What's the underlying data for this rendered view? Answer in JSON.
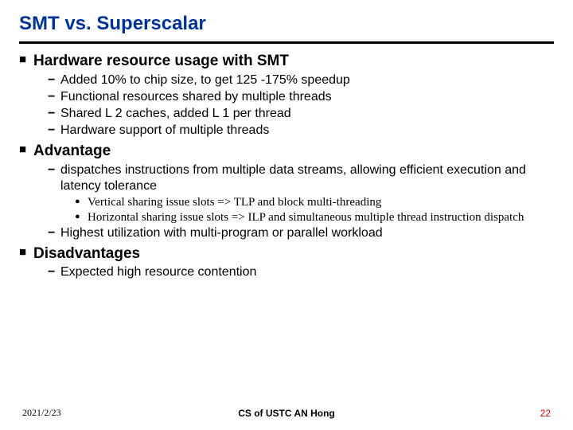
{
  "title": "SMT vs. Superscalar",
  "sections": [
    {
      "heading": "Hardware resource usage with SMT",
      "items": [
        {
          "text": "Added 10% to chip size, to get 125 -175% speedup"
        },
        {
          "text": "Functional resources shared by multiple threads"
        },
        {
          "text": "Shared L 2 caches, added L 1 per thread"
        },
        {
          "text": "Hardware support of multiple threads"
        }
      ]
    },
    {
      "heading": "Advantage",
      "items": [
        {
          "text": "dispatches instructions from multiple data streams, allowing efficient execution and latency tolerance",
          "sub": [
            "Vertical sharing issue slots => TLP and block multi-threading",
            "Horizontal sharing issue slots => ILP and simultaneous multiple thread instruction dispatch"
          ]
        },
        {
          "text": "Highest utilization with multi-program or parallel workload"
        }
      ]
    },
    {
      "heading": "Disadvantages",
      "items": [
        {
          "text": "Expected high resource contention"
        }
      ]
    }
  ],
  "footer": {
    "date": "2021/2/23",
    "center": "CS of USTC AN Hong",
    "page": "22"
  }
}
